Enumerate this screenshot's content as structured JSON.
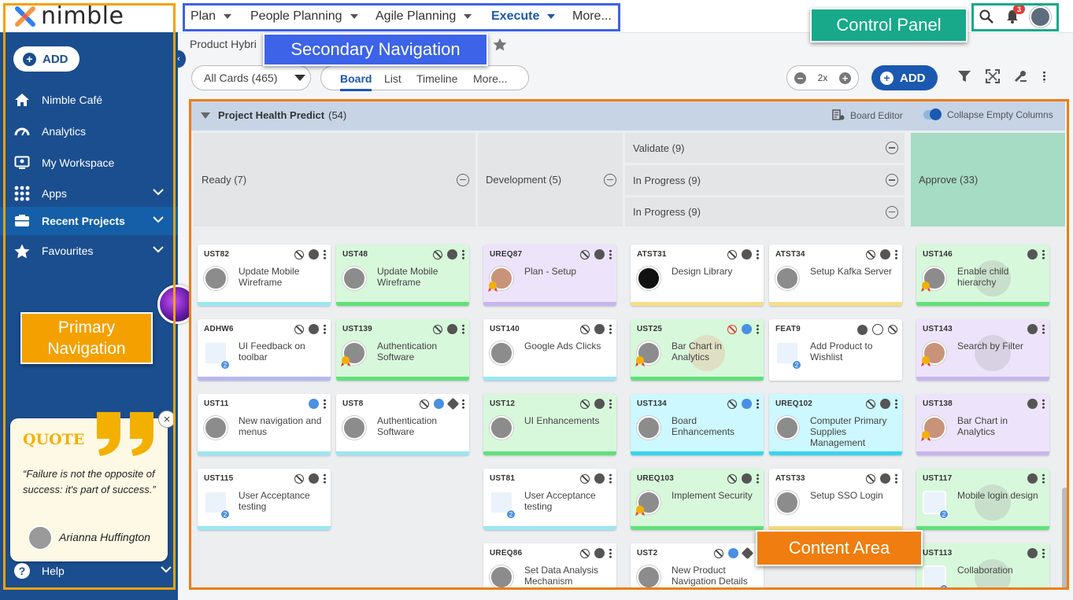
{
  "brand": {
    "logo_text": "nimble"
  },
  "sidebar": {
    "add_label": "ADD",
    "items": [
      {
        "label": "Nimble Café",
        "icon": "home-icon"
      },
      {
        "label": "Analytics",
        "icon": "gauge-icon"
      },
      {
        "label": "My Workspace",
        "icon": "workspace-icon"
      },
      {
        "label": "Apps",
        "icon": "apps-grid-icon"
      },
      {
        "label": "Recent Projects",
        "icon": "projects-icon"
      },
      {
        "label": "Favourites",
        "icon": "star-icon"
      }
    ],
    "help_label": "Help"
  },
  "quote": {
    "title": "QUOTE",
    "text": "“Failure is not the opposite of success: it's part of success.”",
    "author": "Arianna Huffington"
  },
  "topnav": {
    "items": [
      "Plan",
      "People Planning",
      "Agile Planning",
      "Execute",
      "More..."
    ],
    "active": "Execute",
    "notification_count": "3"
  },
  "breadcrumb": {
    "text": "Product Hybri"
  },
  "toolbar": {
    "filter_label": "All Cards (465)",
    "view_tabs": [
      "Board",
      "List",
      "Timeline",
      "More..."
    ],
    "zoom_label": "2x",
    "add_label": "ADD"
  },
  "board": {
    "group_title": "Project Health Predict",
    "group_count": "(54)",
    "board_editor_label": "Board Editor",
    "collapse_label": "Collapse Empty Columns",
    "columns": {
      "ready": "Ready (7)",
      "development": "Development (5)",
      "validate": "Validate (9)",
      "in_progress_a": "In Progress (9)",
      "in_progress_b": "In Progress (9)",
      "approve": "Approve (33)"
    },
    "cards": [
      {
        "id": "UST82",
        "title": "Update Mobile Wireframe"
      },
      {
        "id": "UST48",
        "title": "Update Mobile Wireframe"
      },
      {
        "id": "UREQ87",
        "title": "Plan - Setup"
      },
      {
        "id": "ATST31",
        "title": "Design Library"
      },
      {
        "id": "ATST34",
        "title": "Setup Kafka Server"
      },
      {
        "id": "UST146",
        "title": "Enable child hierarchy"
      },
      {
        "id": "ADHW6",
        "title": "UI Feedback on toolbar"
      },
      {
        "id": "UST139",
        "title": "Authentication Software"
      },
      {
        "id": "UST140",
        "title": "Google Ads Clicks"
      },
      {
        "id": "UST25",
        "title": "Bar Chart in Analytics"
      },
      {
        "id": "FEAT9",
        "title": "Add Product to Wishlist"
      },
      {
        "id": "UST143",
        "title": "Search by Filter"
      },
      {
        "id": "UST11",
        "title": "New navigation and menus"
      },
      {
        "id": "UST8",
        "title": "Authentication Software"
      },
      {
        "id": "UST12",
        "title": "UI Enhancements"
      },
      {
        "id": "UST134",
        "title": "Board Enhancements"
      },
      {
        "id": "UREQ102",
        "title": "Computer Primary Supplies Management"
      },
      {
        "id": "UST138",
        "title": "Bar Chart in Analytics"
      },
      {
        "id": "UST115",
        "title": "User Acceptance testing"
      },
      {
        "id": "UST81",
        "title": "User Acceptance testing"
      },
      {
        "id": "UREQ103",
        "title": "Implement Security"
      },
      {
        "id": "ATST33",
        "title": "Setup SSO Login"
      },
      {
        "id": "UST117",
        "title": "Mobile login design"
      },
      {
        "id": "UREQ86",
        "title": "Set Data Analysis Mechanism"
      },
      {
        "id": "UST2",
        "title": "New Product Navigation Details"
      },
      {
        "id": "UST113",
        "title": "Collaboration"
      }
    ]
  },
  "callouts": {
    "secondary": "Secondary Navigation",
    "primary": "Primary Navigation",
    "control": "Control Panel",
    "content": "Content Area"
  },
  "colors": {
    "sidebar_bg": "#1b4e8f",
    "accent_blue": "#1b58b0",
    "card_green": "#d8f8dc",
    "card_purple": "#ede4fb",
    "card_cyan": "#cdf8ff",
    "approve_header": "#a6dbc4",
    "callout_orange": "#ef7d10",
    "callout_yellow": "#f4a100",
    "callout_teal": "#17a98a",
    "callout_blue": "#3c63e8"
  }
}
